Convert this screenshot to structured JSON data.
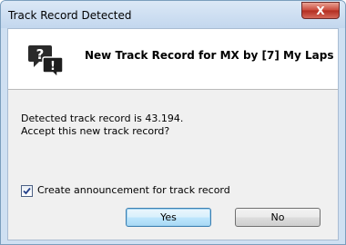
{
  "window": {
    "title": "Track Record Detected",
    "close_label": "X"
  },
  "header": {
    "icon": "speech-bubbles-question-exclamation-icon",
    "title": "New Track Record for MX by [7] My Laps"
  },
  "message": {
    "line1": "Detected track record is 43.194.",
    "line2": "Accept this new track record?"
  },
  "checkbox": {
    "label": "Create announcement for track record",
    "checked": true
  },
  "buttons": {
    "yes_label": "Yes",
    "no_label": "No"
  },
  "colors": {
    "accent": "#3c7fb1",
    "close": "#c9483a",
    "icon": "#2a2a2a"
  }
}
